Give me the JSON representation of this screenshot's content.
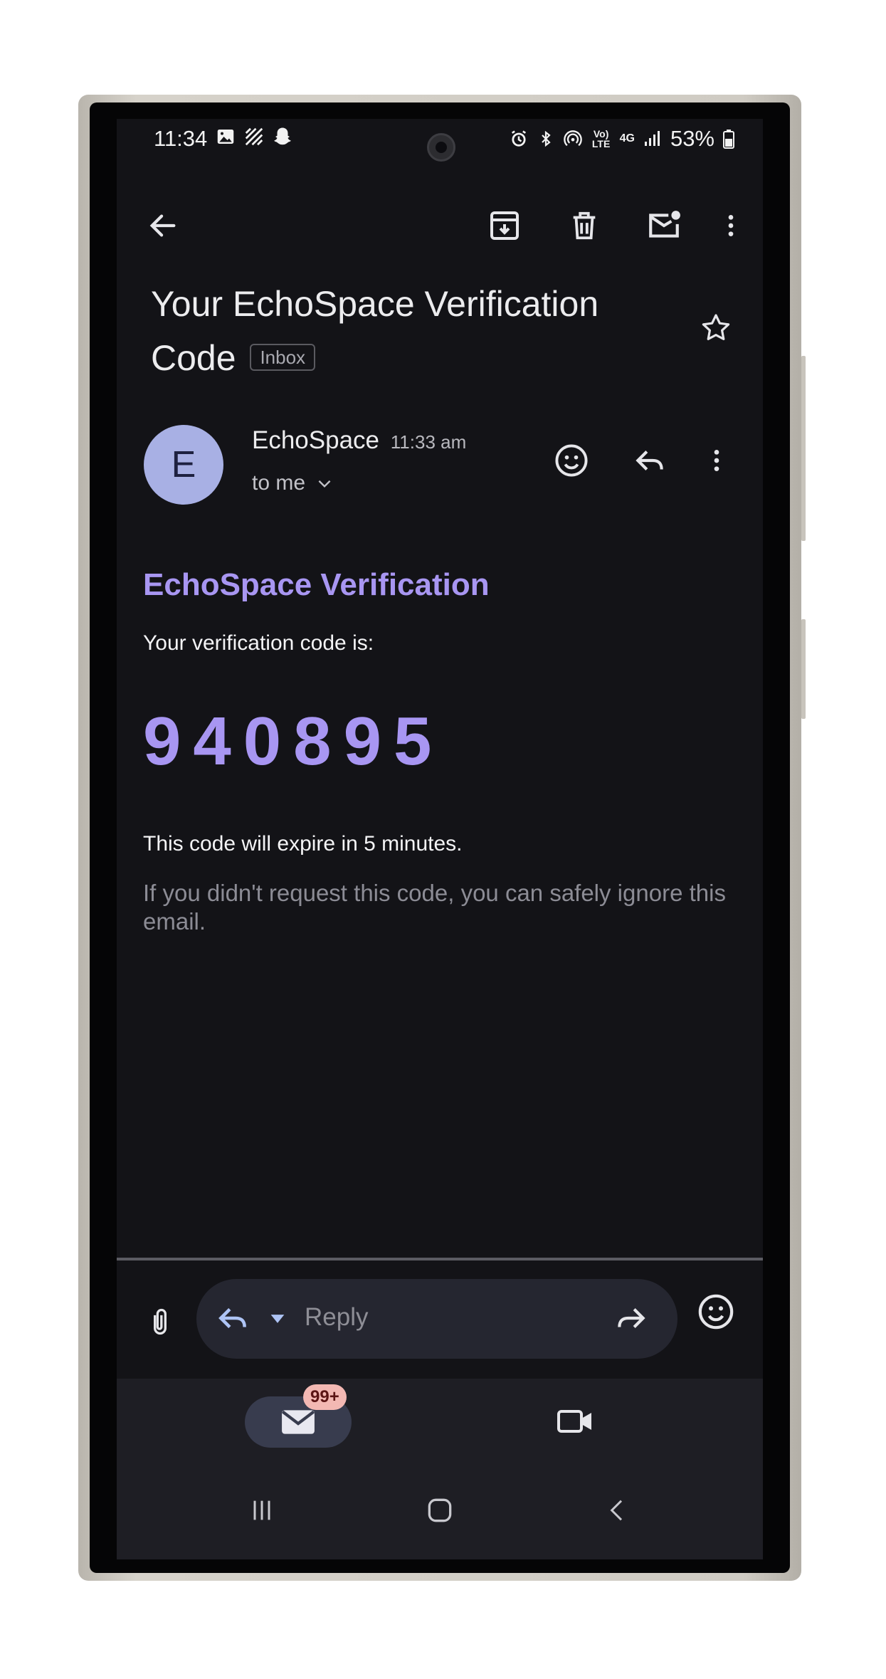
{
  "status_bar": {
    "time": "11:34",
    "left_icons": [
      "image-icon",
      "hatch-icon",
      "snapchat-icon"
    ],
    "right_icons": [
      "alarm-icon",
      "bluetooth-icon",
      "hotspot-icon",
      "volte-icon",
      "4g-icon",
      "signal-icon"
    ],
    "volte_label": "Vo) LTE",
    "network_label": "4G",
    "battery_percent": "53%"
  },
  "toolbar": {
    "back": "back-arrow-icon",
    "archive": "archive-icon",
    "delete": "trash-icon",
    "mark_unread": "mark-unread-icon",
    "more": "more-vert-icon"
  },
  "email": {
    "subject_line1": "Your EchoSpace Verification",
    "subject_line2": "Code",
    "label": "Inbox",
    "sender_initial": "E",
    "sender_name": "EchoSpace",
    "sent_time": "11:33 am",
    "recipient": "to me",
    "body": {
      "heading": "EchoSpace Verification",
      "intro": "Your verification code is:",
      "code": "940895",
      "expire_note": "This code will expire in 5 minutes.",
      "ignore_note": "If you didn't request this code, you can safely ignore this email."
    }
  },
  "compose": {
    "reply_placeholder": "Reply"
  },
  "bottom_nav": {
    "mail_badge": "99+"
  },
  "colors": {
    "accent": "#a896f2",
    "background": "#131317",
    "avatar": "#a8b0e4",
    "badge": "#f3b8b3"
  }
}
